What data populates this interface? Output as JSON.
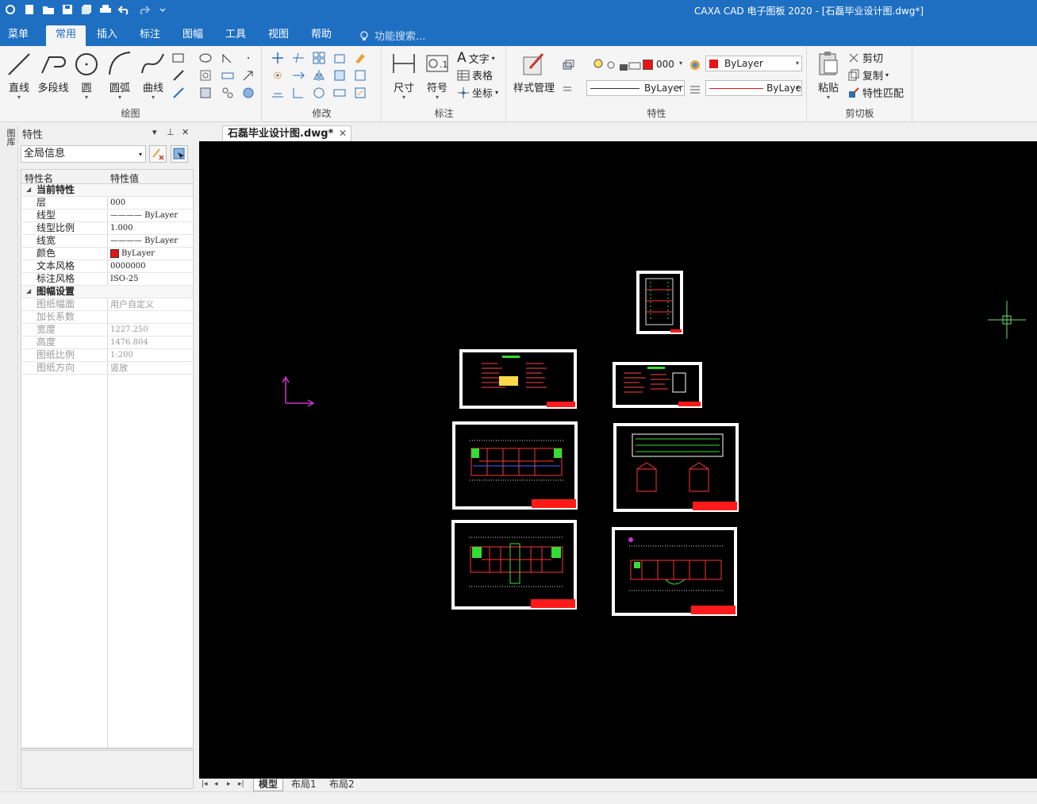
{
  "window": {
    "title": "CAXA CAD 电子图板 2020 - [石磊毕业设计图.dwg*]"
  },
  "tabs": [
    "菜单",
    "常用",
    "插入",
    "标注",
    "图幅",
    "工具",
    "视图",
    "帮助"
  ],
  "active_tab": "常用",
  "search_placeholder": "功能搜索...",
  "ribbon": {
    "draw": {
      "label": "绘图",
      "line": "直线",
      "polyline": "多段线",
      "circle": "圆",
      "arc": "圆弧",
      "curve": "曲线"
    },
    "modify": {
      "label": "修改"
    },
    "annotate": {
      "label": "标注",
      "dimension": "尺寸",
      "symbol": "符号",
      "text": "文字",
      "table": "表格",
      "coordinate": "坐标"
    },
    "properties": {
      "label": "特性",
      "style_manager": "样式管理",
      "layer_value": "000",
      "color_value": "ByLayer",
      "linetype_value": "ByLayer",
      "lineweight_value": "ByLaye"
    },
    "clipboard": {
      "label": "剪切板",
      "paste": "粘贴",
      "cut": "剪切",
      "copy": "复制",
      "match": "特性匹配"
    }
  },
  "left_strip": {
    "label": "图库"
  },
  "panel": {
    "title": "特性",
    "pin": "▾  ⊥  ✕",
    "filter": "全局信息",
    "col_name": "特性名",
    "col_value": "特性值",
    "rows": [
      {
        "name": "当前特性",
        "value": ""
      },
      {
        "name": "层",
        "value": "000"
      },
      {
        "name": "线型",
        "value": "———— ByLayer"
      },
      {
        "name": "线型比例",
        "value": "1.000"
      },
      {
        "name": "线宽",
        "value": "———— ByLayer"
      },
      {
        "name": "颜色",
        "value": "ByLayer"
      },
      {
        "name": "文本风格",
        "value": "0000000"
      },
      {
        "name": "标注风格",
        "value": "ISO-25"
      },
      {
        "name": "图幅设置",
        "value": ""
      },
      {
        "name": "图纸幅面",
        "value": "用户自定义"
      },
      {
        "name": "加长系数",
        "value": ""
      },
      {
        "name": "宽度",
        "value": "1227.250"
      },
      {
        "name": "高度",
        "value": "1476.804"
      },
      {
        "name": "图纸比例",
        "value": "1:200"
      },
      {
        "name": "图纸方向",
        "value": "竖放"
      }
    ]
  },
  "document_tab": "石磊毕业设计图.dwg*",
  "layout_tabs": [
    "模型",
    "布局1",
    "布局2"
  ],
  "colors": {
    "accent": "#1e6fc2",
    "canvas": "#000000",
    "titleblock": "#ff1a1a",
    "ucs": "#cc33cc",
    "crosshair": "#6ee06e"
  }
}
